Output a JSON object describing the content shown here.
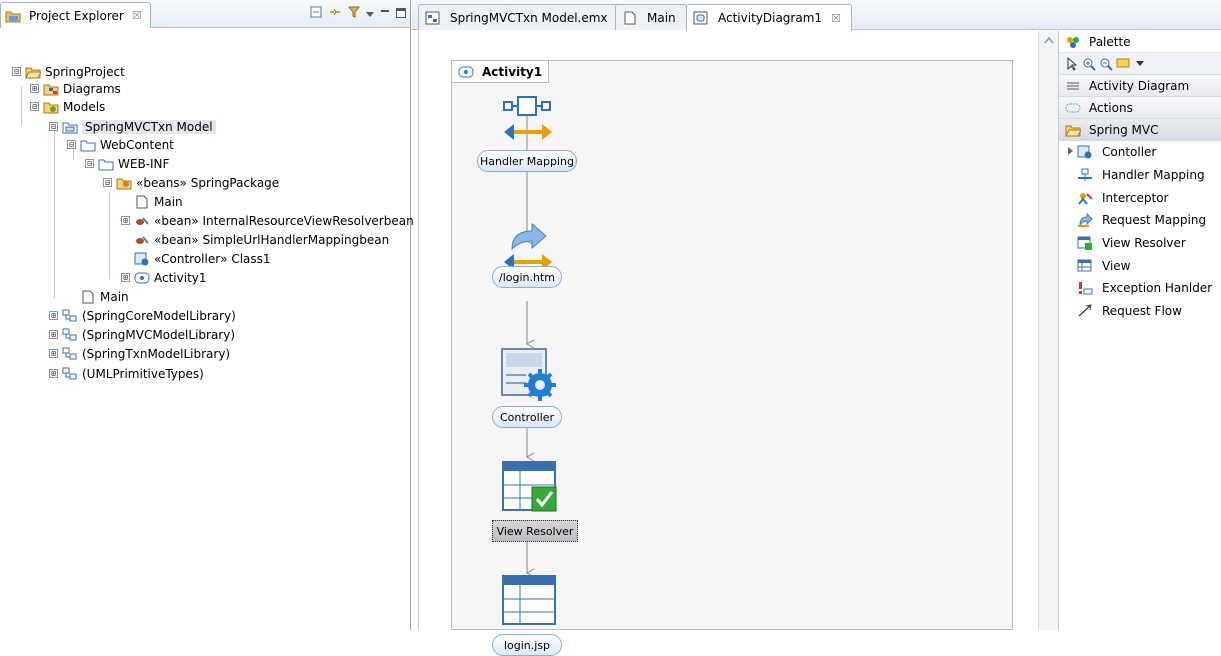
{
  "explorer": {
    "title": "Project Explorer",
    "tab_close": "☒",
    "tree": [
      {
        "label": "SpringProject",
        "expander": "⊟"
      },
      {
        "label": "Diagrams",
        "expander": "⊞"
      },
      {
        "label": "Models",
        "expander": "⊟"
      },
      {
        "label": "SpringMVCTxn Model",
        "expander": "⊟"
      },
      {
        "label": "WebContent",
        "expander": "⊟"
      },
      {
        "label": "WEB-INF",
        "expander": "⊟"
      },
      {
        "label": "«beans» SpringPackage",
        "expander": "⊟"
      },
      {
        "label": "Main",
        "expander": ""
      },
      {
        "label": "«bean» InternalResourceViewResolverbean",
        "expander": "⊞"
      },
      {
        "label": "«bean» SimpleUrlHandlerMappingbean",
        "expander": ""
      },
      {
        "label": "«Controller» Class1",
        "expander": ""
      },
      {
        "label": "Activity1",
        "expander": "⊞"
      },
      {
        "label": "Main",
        "expander": ""
      },
      {
        "label": "(SpringCoreModelLibrary)",
        "expander": "⊞"
      },
      {
        "label": "(SpringMVCModelLibrary)",
        "expander": "⊞"
      },
      {
        "label": "(SpringTxnModelLibrary)",
        "expander": "⊞"
      },
      {
        "label": "(UMLPrimitiveTypes)",
        "expander": "⊞"
      }
    ]
  },
  "editor_tabs": [
    {
      "label": "SpringMVCTxn Model.emx"
    },
    {
      "label": "Main"
    },
    {
      "label": "ActivityDiagram1",
      "close": "☒"
    }
  ],
  "diagram": {
    "activity_title": "Activity1",
    "nodes": [
      {
        "label": "Handler Mapping"
      },
      {
        "label": "/login.htm"
      },
      {
        "label": "Controller"
      },
      {
        "label": "View Resolver"
      },
      {
        "label": "login.jsp"
      }
    ]
  },
  "palette": {
    "title": "Palette",
    "drawers": [
      {
        "label": "Activity Diagram"
      },
      {
        "label": "Actions"
      },
      {
        "label": "Spring MVC"
      }
    ],
    "items": [
      {
        "label": "Contoller"
      },
      {
        "label": "Handler Mapping"
      },
      {
        "label": "Interceptor"
      },
      {
        "label": "Request Mapping"
      },
      {
        "label": "View Resolver"
      },
      {
        "label": "View"
      },
      {
        "label": "Exception Hanlder"
      },
      {
        "label": "Request Flow"
      }
    ]
  }
}
